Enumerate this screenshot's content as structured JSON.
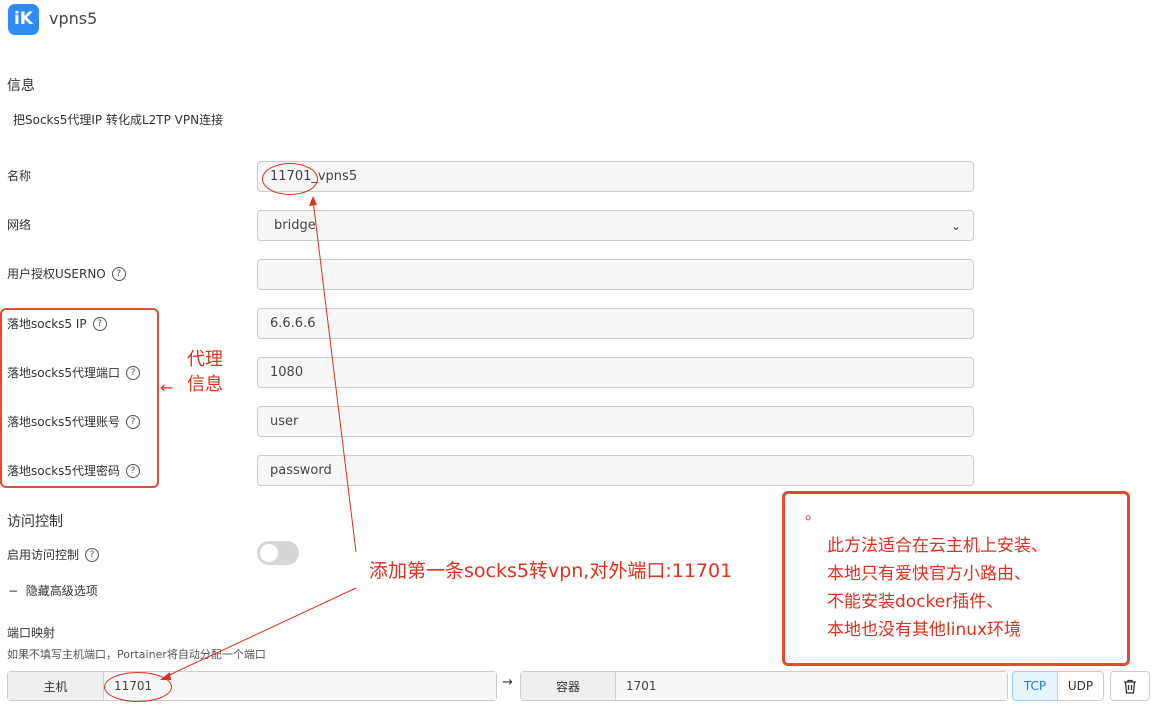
{
  "app": {
    "title": "vpns5",
    "logo_text": "iK"
  },
  "info": {
    "heading": "信息",
    "description": "把Socks5代理IP 转化成L2TP VPN连接"
  },
  "form": {
    "name": {
      "label": "名称",
      "value": "11701_vpns5"
    },
    "network": {
      "label": "网络",
      "value": "bridge"
    },
    "userno": {
      "label": "用户授权USERNO",
      "value": ""
    },
    "socks_ip": {
      "label": "落地socks5 IP",
      "value": "6.6.6.6"
    },
    "socks_port": {
      "label": "落地socks5代理端口",
      "value": "1080"
    },
    "socks_user": {
      "label": "落地socks5代理账号",
      "value": "user"
    },
    "socks_pass": {
      "label": "落地socks5代理密码",
      "value": "password"
    }
  },
  "access": {
    "heading": "访问控制",
    "enable_label": "启用访问控制",
    "enabled": false
  },
  "advanced": {
    "toggle_label": "隐藏高级选项",
    "toggle_icon": "−"
  },
  "ports": {
    "heading": "端口映射",
    "hint": "如果不填写主机端口，Portainer将自动分配一个端口",
    "host_label": "主机",
    "host_value": "11701",
    "container_label": "容器",
    "container_value": "1701",
    "tcp": "TCP",
    "udp": "UDP",
    "arrow": "→"
  },
  "annotations": {
    "proxy_info_line1": "代理",
    "proxy_info_line2": "信息",
    "proxy_arrow": "←",
    "add_rule": "添加第一条socks5转vpn,对外端口:11701",
    "note_dot": "。",
    "note_lines": [
      "此方法适合在云主机上安装、",
      "本地只有爱快官方小路由、",
      "不能安装docker插件、",
      "本地也没有其他linux环境"
    ]
  },
  "colors": {
    "accent": "#2f8cf5",
    "annotation_red": "#e0301e"
  }
}
